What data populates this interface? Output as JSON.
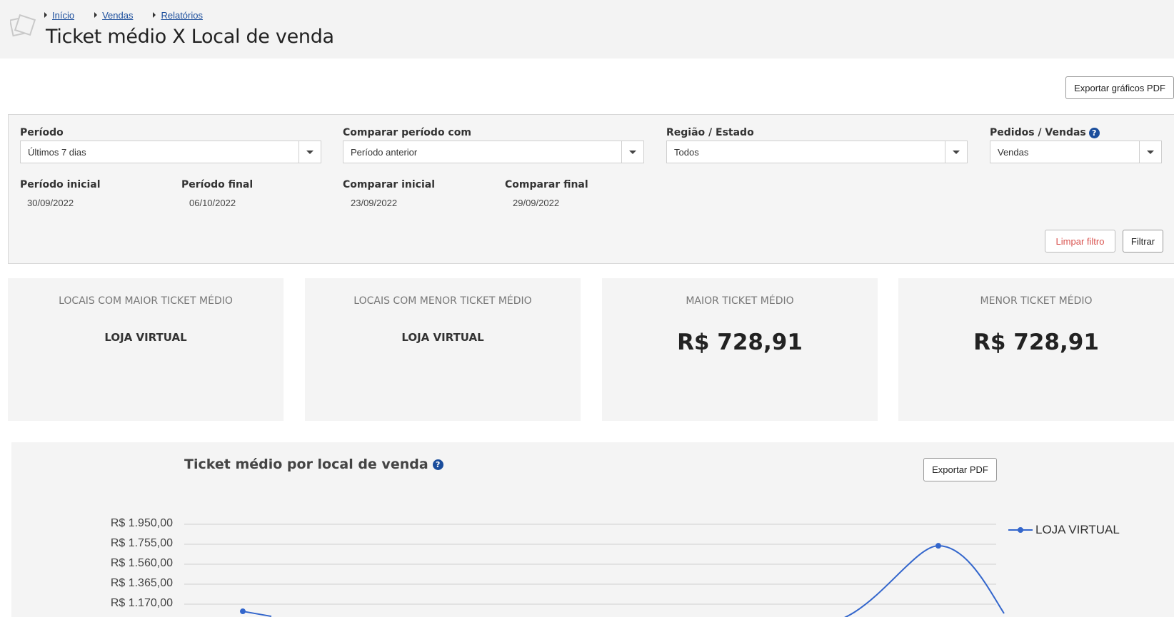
{
  "breadcrumb": [
    "Início",
    "Vendas",
    "Relatórios"
  ],
  "page_title": "Ticket médio X Local de venda",
  "export_charts_label": "Exportar gráficos PDF",
  "filters": {
    "periodo": {
      "label": "Período",
      "value": "Últimos 7 dias"
    },
    "comparar": {
      "label": "Comparar período com",
      "value": "Período anterior"
    },
    "regiao": {
      "label": "Região / Estado",
      "value": "Todos"
    },
    "pedidos": {
      "label": "Pedidos / Vendas",
      "value": "Vendas",
      "help": "?"
    },
    "periodo_inicial": {
      "label": "Período inicial",
      "value": "30/09/2022"
    },
    "periodo_final": {
      "label": "Período final",
      "value": "06/10/2022"
    },
    "comparar_inicial": {
      "label": "Comparar inicial",
      "value": "23/09/2022"
    },
    "comparar_final": {
      "label": "Comparar final",
      "value": "29/09/2022"
    },
    "clear_label": "Limpar filtro",
    "filter_label": "Filtrar"
  },
  "cards": [
    {
      "title": "LOCAIS COM MAIOR TICKET MÉDIO",
      "value": "LOJA VIRTUAL"
    },
    {
      "title": "LOCAIS COM MENOR TICKET MÉDIO",
      "value": "LOJA VIRTUAL"
    },
    {
      "title": "MAIOR TICKET MÉDIO",
      "value": "R$ 728,91"
    },
    {
      "title": "MENOR TICKET MÉDIO",
      "value": "R$ 728,91"
    }
  ],
  "chart_section": {
    "title": "Ticket médio por local de venda",
    "help": "?",
    "export_label": "Exportar PDF"
  },
  "chart_data": {
    "type": "line",
    "title": "Ticket médio por local de venda",
    "y_ticks": [
      "R$ 1.950,00",
      "R$ 1.755,00",
      "R$ 1.560,00",
      "R$ 1.365,00",
      "R$ 1.170,00"
    ],
    "ylim_visible": [
      1170,
      1950
    ],
    "legend_position": "right",
    "grid": true,
    "series": [
      {
        "name": "LOJA VIRTUAL",
        "color": "#3366cc",
        "points": [
          {
            "index": 0,
            "y": 1100
          },
          {
            "index": 2,
            "y": 1740
          }
        ]
      }
    ]
  }
}
